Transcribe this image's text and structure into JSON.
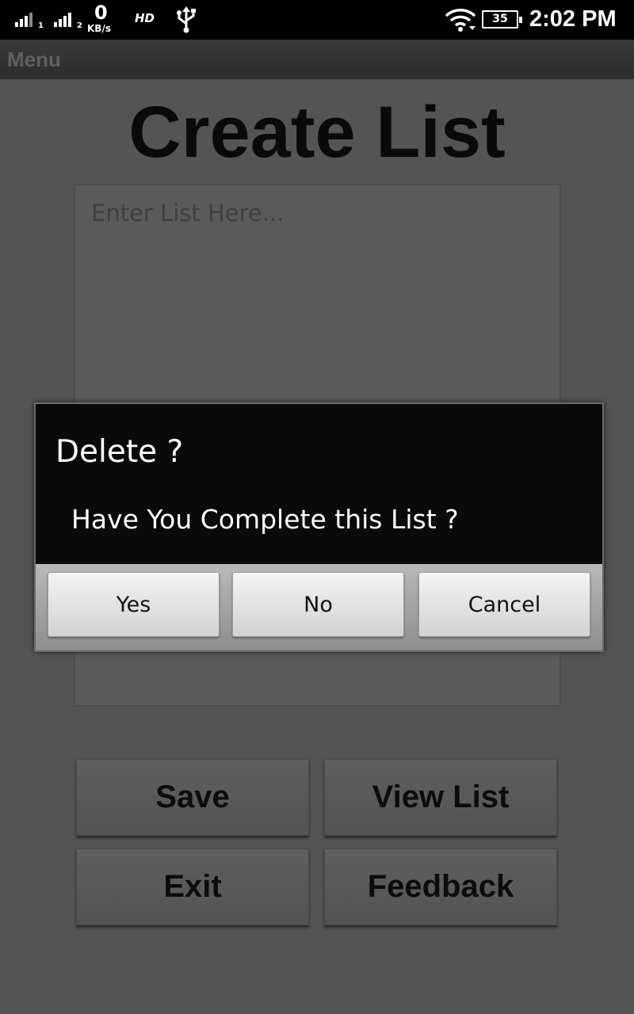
{
  "status_bar": {
    "sim1_label": "1",
    "sim2_label": "2",
    "network_speed_value": "0",
    "network_speed_unit": "KB/s",
    "hd_label": "HD",
    "battery_level": "35",
    "time": "2:02 PM",
    "icons": [
      "signal-icon",
      "signal-icon",
      "usb-icon",
      "wifi-icon",
      "battery-icon"
    ]
  },
  "action_bar": {
    "menu_label": "Menu"
  },
  "page": {
    "title": "Create List",
    "list_placeholder": "Enter List Here..."
  },
  "buttons": {
    "save": "Save",
    "view_list": "View List",
    "exit": "Exit",
    "feedback": "Feedback"
  },
  "dialog": {
    "title": "Delete ?",
    "message": "Have You Complete this List ?",
    "yes": "Yes",
    "no": "No",
    "cancel": "Cancel"
  }
}
